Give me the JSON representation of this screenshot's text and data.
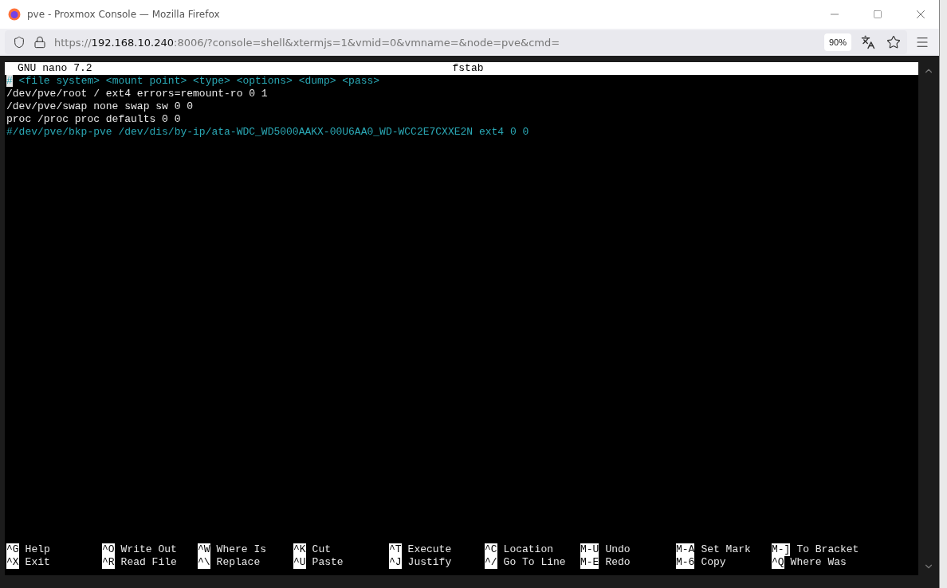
{
  "window": {
    "title": "pve - Proxmox Console — Mozilla Firefox"
  },
  "address_bar": {
    "scheme": "https://",
    "host": "192.168.10.240",
    "rest": ":8006/?console=shell&xtermjs=1&vmid=0&vmname=&node=pve&cmd=",
    "zoom": "90%"
  },
  "editor": {
    "app": "GNU nano 7.2",
    "file": "fstab",
    "lines": [
      {
        "text": "# <file system> <mount point> <type> <options> <dump> <pass>",
        "kind": "comment",
        "cursor": true
      },
      {
        "text": "/dev/pve/root / ext4 errors=remount-ro 0 1",
        "kind": "plain",
        "cursor": false
      },
      {
        "text": "/dev/pve/swap none swap sw 0 0",
        "kind": "plain",
        "cursor": false
      },
      {
        "text": "proc /proc proc defaults 0 0",
        "kind": "plain",
        "cursor": false
      },
      {
        "text": "#/dev/pve/bkp-pve /dev/dis/by-ip/ata-WDC_WD5000AAKX-00U6AA0_WD-WCC2E7CXXE2N ext4 0 0",
        "kind": "comment",
        "cursor": false
      }
    ],
    "shortcuts": [
      [
        {
          "key": "^G",
          "label": "Help"
        },
        {
          "key": "^X",
          "label": "Exit"
        }
      ],
      [
        {
          "key": "^O",
          "label": "Write Out"
        },
        {
          "key": "^R",
          "label": "Read File"
        }
      ],
      [
        {
          "key": "^W",
          "label": "Where Is"
        },
        {
          "key": "^\\",
          "label": "Replace"
        }
      ],
      [
        {
          "key": "^K",
          "label": "Cut"
        },
        {
          "key": "^U",
          "label": "Paste"
        }
      ],
      [
        {
          "key": "^T",
          "label": "Execute"
        },
        {
          "key": "^J",
          "label": "Justify"
        }
      ],
      [
        {
          "key": "^C",
          "label": "Location"
        },
        {
          "key": "^/",
          "label": "Go To Line"
        }
      ],
      [
        {
          "key": "M-U",
          "label": "Undo"
        },
        {
          "key": "M-E",
          "label": "Redo"
        }
      ],
      [
        {
          "key": "M-A",
          "label": "Set Mark"
        },
        {
          "key": "M-6",
          "label": "Copy"
        }
      ],
      [
        {
          "key": "M-]",
          "label": "To Bracket"
        },
        {
          "key": "^Q",
          "label": "Where Was"
        }
      ]
    ]
  }
}
